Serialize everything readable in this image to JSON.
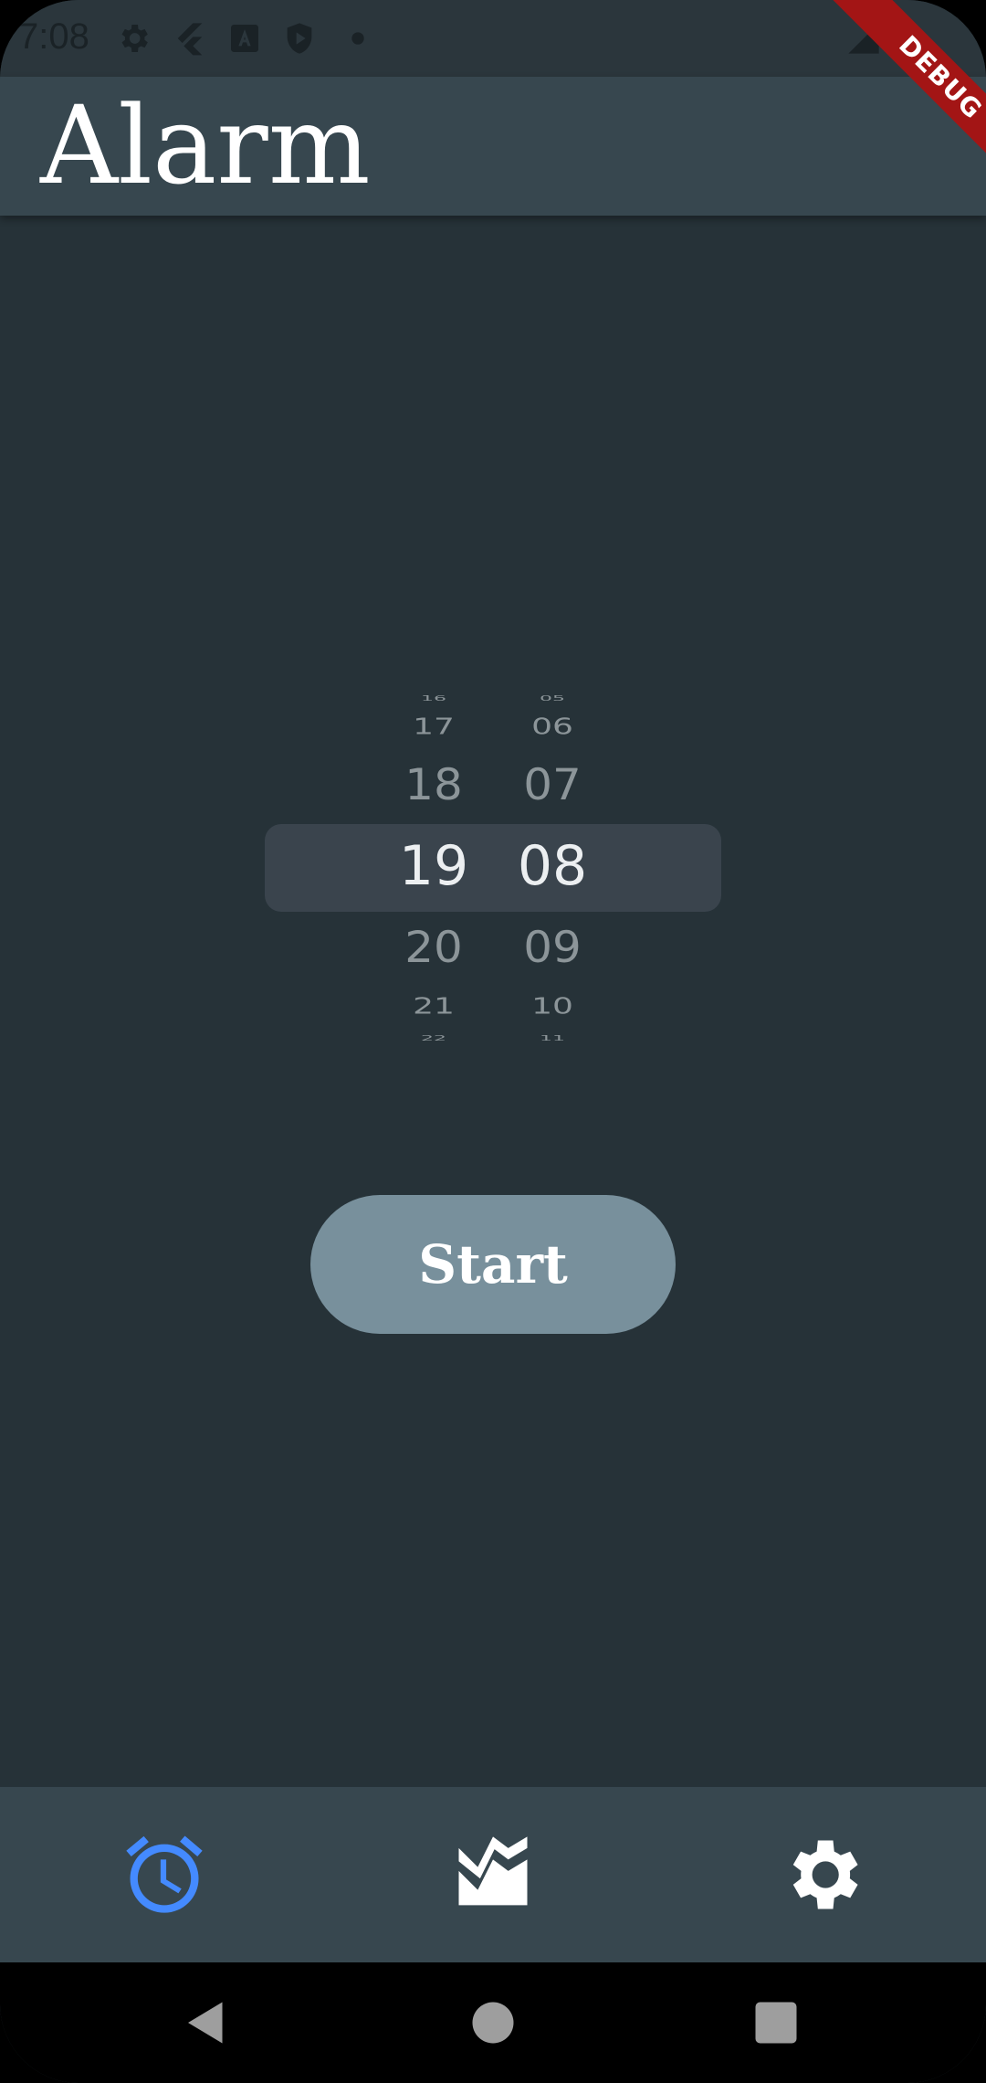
{
  "status_bar": {
    "time": "7:08",
    "icons": [
      "gear-icon",
      "flutter-icon",
      "font-a-icon",
      "shield-play-icon",
      "dot-icon",
      "signal-icon"
    ]
  },
  "debug_banner": {
    "label": "DEBUG"
  },
  "app_bar": {
    "title": "Alarm"
  },
  "time_picker": {
    "hours": {
      "values": [
        "16",
        "17",
        "18",
        "19",
        "20",
        "21",
        "22"
      ],
      "selected": "19"
    },
    "minutes": {
      "values": [
        "05",
        "06",
        "07",
        "08",
        "09",
        "10",
        "11"
      ],
      "selected": "08"
    }
  },
  "start_button": {
    "label": "Start"
  },
  "bottom_nav": {
    "items": [
      {
        "icon": "alarm-icon",
        "active": true
      },
      {
        "icon": "chart-icon",
        "active": false
      },
      {
        "icon": "settings-icon",
        "active": false
      }
    ],
    "active_color": "#448aff",
    "inactive_color": "#ffffff"
  },
  "system_nav": {
    "buttons": [
      "back-icon",
      "home-icon",
      "recents-icon"
    ]
  },
  "colors": {
    "background": "#263238",
    "app_bar": "#37474f",
    "button": "#78909c",
    "debug": "#a31515"
  }
}
